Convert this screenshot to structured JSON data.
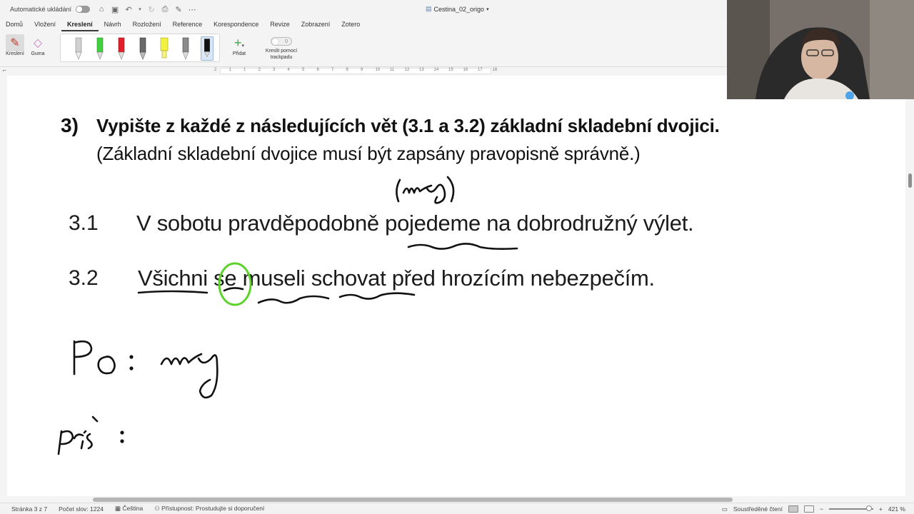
{
  "titlebar": {
    "autosave_label": "Automatické ukládání",
    "document_title": "Cestina_02_origo"
  },
  "ribbon": {
    "tabs": [
      "Domů",
      "Vložení",
      "Kreslení",
      "Návrh",
      "Rozložení",
      "Reference",
      "Korespondence",
      "Revize",
      "Zobrazení",
      "Zotero"
    ],
    "active_tab": "Kreslení",
    "draw_label": "Kreslení",
    "eraser_label": "Guma",
    "add_label": "Přidat",
    "trackpad_label_1": "Kreslit pomocí",
    "trackpad_label_2": "trackpadu",
    "trackpad_toggle_text": "0",
    "pen_colors": [
      "#d0d0d0",
      "#3ed03e",
      "#e0202a",
      "#6a6a6a",
      "#f2f040",
      "#8a8a8a",
      "#111111"
    ]
  },
  "ruler": {
    "numbers": [
      "2",
      "1",
      "1",
      "2",
      "3",
      "4",
      "5",
      "6",
      "7",
      "8",
      "9",
      "10",
      "11",
      "12",
      "13",
      "14",
      "15",
      "16",
      "17",
      "18"
    ]
  },
  "document": {
    "task_number": "3)",
    "task_title": "Vypište z každé z následujících vět (3.1 a 3.2) základní skladební dvojici.",
    "task_subtitle": "(Základní skladební dvojice musí být zapsány pravopisně správně.)",
    "sentence_1_num": "3.1",
    "sentence_1_text": "V sobotu pravděpodobně pojedeme na dobrodružný výlet.",
    "sentence_2_num": "3.2",
    "sentence_2_text": "Všichni se museli schovat před hrozícím nebezpečím."
  },
  "statusbar": {
    "page": "Stránka 3 z 7",
    "word_count": "Počet slov: 1224",
    "language": "Čeština",
    "accessibility": "Přístupnost: Prostudujte si doporučení",
    "focus_mode": "Soustředěné čtení",
    "zoom": "421 %"
  },
  "colors": {
    "ink": "#111111",
    "green_circle": "#5cd22a",
    "accent_selected": "#d9e6f6"
  }
}
